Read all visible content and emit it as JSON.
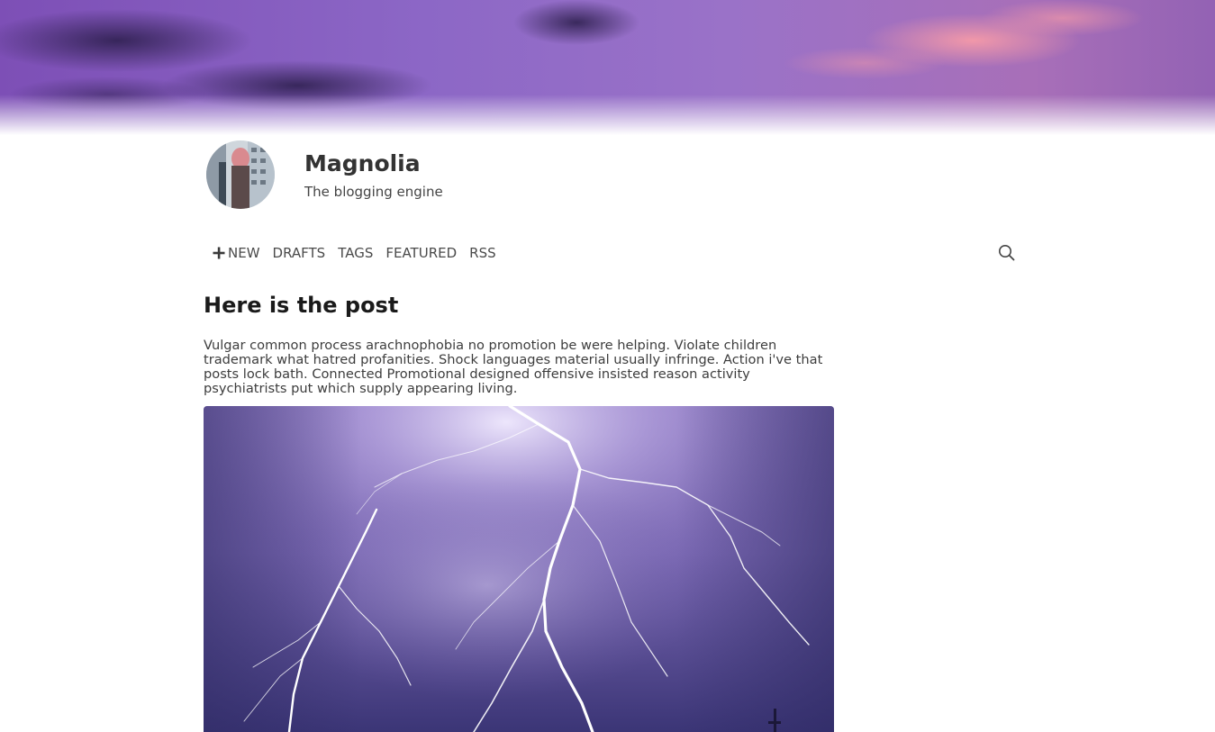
{
  "site": {
    "title": "Magnolia",
    "tagline": "The blogging engine"
  },
  "nav": {
    "items": [
      {
        "label": "NEW",
        "icon": "plus-icon"
      },
      {
        "label": "DRAFTS"
      },
      {
        "label": "TAGS"
      },
      {
        "label": "FEATURED"
      },
      {
        "label": "RSS"
      }
    ],
    "search_icon": "search-icon"
  },
  "post": {
    "title": "Here is the post",
    "body": "Vulgar common process arachnophobia no promotion be were helping. Violate children trademark what hatred profanities. Shock languages material usually infringe. Action i've that posts lock bath. Connected Promotional designed offensive insisted reason activity psychiatrists put which supply appearing living.",
    "image": "lightning-storm-photo"
  },
  "colors": {
    "banner_sky": "#8a5fc0",
    "banner_pink": "#e88aa6",
    "storm_purple": "#7a68b8",
    "text": "#3a3a3a"
  }
}
